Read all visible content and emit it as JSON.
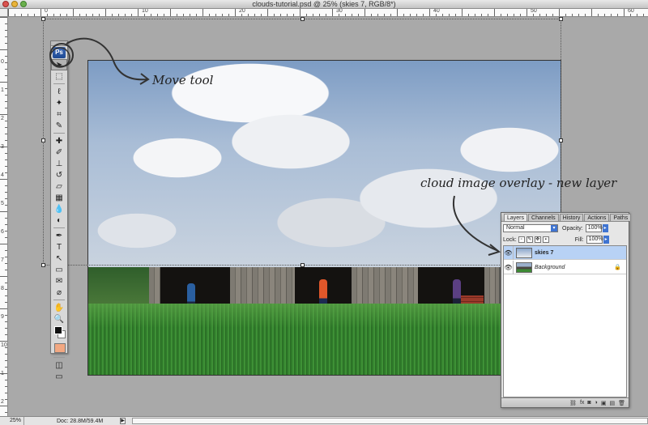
{
  "window": {
    "title": "clouds-tutorial.psd @ 25% (skies 7, RGB/8*)"
  },
  "rulers": {
    "top_numbers": [
      "0",
      "10",
      "20",
      "30",
      "40",
      "50",
      "60"
    ],
    "left_numbers": [
      "0",
      "1",
      "2",
      "3",
      "4",
      "5",
      "6",
      "7",
      "8",
      "9",
      "10",
      "1",
      "2"
    ]
  },
  "toolbox": {
    "logo": "Ps",
    "tools": [
      {
        "name": "move",
        "glyph": "➤"
      },
      {
        "name": "marquee",
        "glyph": "⬚"
      },
      {
        "name": "lasso",
        "glyph": "ℓ"
      },
      {
        "name": "magic-wand",
        "glyph": "✦"
      },
      {
        "name": "crop",
        "glyph": "⌗"
      },
      {
        "name": "eyedropper",
        "glyph": "✎"
      },
      {
        "name": "healing",
        "glyph": "✚"
      },
      {
        "name": "brush",
        "glyph": "✐"
      },
      {
        "name": "stamp",
        "glyph": "⊥"
      },
      {
        "name": "history-brush",
        "glyph": "↺"
      },
      {
        "name": "eraser",
        "glyph": "▱"
      },
      {
        "name": "gradient",
        "glyph": "▦"
      },
      {
        "name": "blur",
        "glyph": "💧"
      },
      {
        "name": "dodge",
        "glyph": "◐"
      },
      {
        "name": "pen",
        "glyph": "✒"
      },
      {
        "name": "type",
        "glyph": "T"
      },
      {
        "name": "path-selection",
        "glyph": "↖"
      },
      {
        "name": "shape",
        "glyph": "▭"
      },
      {
        "name": "notes",
        "glyph": "✉"
      },
      {
        "name": "eyedropper2",
        "glyph": "⌀"
      },
      {
        "name": "hand",
        "glyph": "✋"
      },
      {
        "name": "zoom",
        "glyph": "🔍"
      }
    ],
    "quick_mask_glyph": "◫",
    "screen_mode_glyph": "▭",
    "background_color": "#f2a882"
  },
  "annotations": {
    "move_tool": "Move tool",
    "cloud_overlay": "cloud image overlay - new layer"
  },
  "layers_panel": {
    "tabs": [
      "Layers",
      "Channels",
      "History",
      "Actions",
      "Paths"
    ],
    "active_tab": "Layers",
    "blend_mode": "Normal",
    "opacity_label": "Opacity:",
    "opacity_value": "100%",
    "lock_label": "Lock:",
    "fill_label": "Fill:",
    "fill_value": "100%",
    "layers": [
      {
        "name": "skies 7",
        "selected": true
      },
      {
        "name": "Background",
        "selected": false,
        "locked": true
      }
    ],
    "bottom_icons": [
      "⛓",
      "fx",
      "◙",
      "◑",
      "▣",
      "▤",
      "🗑"
    ]
  },
  "statusbar": {
    "zoom": "25%",
    "doc": "Doc: 28.8M/59.4M",
    "arrow": "▶"
  }
}
